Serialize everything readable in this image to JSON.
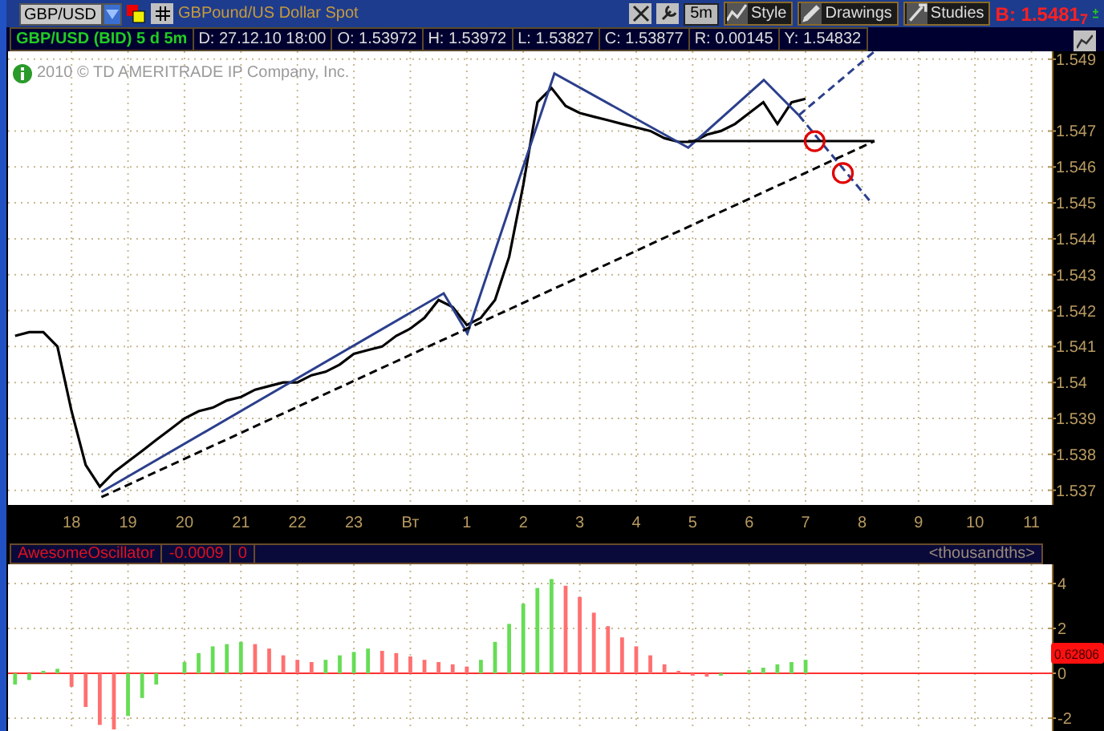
{
  "toolbar": {
    "symbol": "GBP/USD",
    "description": "GBPound/US Dollar Spot",
    "interval": "5m",
    "buttons": [
      {
        "label": "Style"
      },
      {
        "label": "Drawings"
      },
      {
        "label": "Studies"
      }
    ],
    "bid": "B: 1.5481$_{7}$"
  },
  "info_bar": {
    "title": "GBP/USD (BID) 5 d 5m",
    "fields": [
      "D: 27.12.10 18:00",
      "O: 1.53972",
      "H: 1.53972",
      "L: 1.53827",
      "C: 1.53877",
      "R: 0.00145",
      "Y: 1.54832"
    ]
  },
  "copyright": "2010 © TD AMERITRADE IP Company, Inc.",
  "price_chart": {
    "chart_data": {
      "type": "line",
      "grid": true,
      "ylim": [
        1.53659,
        1.54922
      ],
      "categories": [
        null,
        null,
        null,
        null,
        "18",
        null,
        null,
        null,
        "19",
        null,
        null,
        null,
        "20",
        null,
        null,
        null,
        "21",
        null,
        null,
        null,
        "22",
        null,
        null,
        null,
        "23",
        null,
        null,
        null,
        "Вт",
        null,
        null,
        null,
        "1",
        null,
        null,
        null,
        "2",
        null,
        null,
        null,
        "3",
        null,
        null,
        null,
        "4",
        null,
        null,
        null,
        "5",
        null,
        null,
        null,
        "6",
        null,
        null,
        null,
        "7",
        null,
        null,
        null,
        "8",
        null,
        null,
        null,
        "9",
        null,
        null,
        null,
        "10",
        null,
        null,
        null,
        "11",
        null
      ],
      "yticks": [
        1.537,
        1.538,
        1.539,
        1.54,
        1.541,
        1.542,
        1.543,
        1.544,
        1.545,
        1.546,
        1.547,
        1.549
      ],
      "series": [
        {
          "color": "#000000",
          "values": [
            1.5413,
            1.5414,
            1.5414,
            1.541,
            1.5392,
            1.5377,
            1.5371,
            1.5375,
            1.5378,
            1.5381,
            1.5384,
            1.5387,
            1.539,
            1.5392,
            1.5393,
            1.5395,
            1.5396,
            1.5398,
            1.5399,
            1.54,
            1.54,
            1.5402,
            1.5403,
            1.5405,
            1.5408,
            1.5409,
            1.541,
            1.5413,
            1.5415,
            1.5418,
            1.5423,
            1.5421,
            1.5416,
            1.5418,
            1.5423,
            1.5435,
            1.5455,
            1.5478,
            1.5482,
            1.5477,
            1.5475,
            1.5474,
            1.5473,
            1.5472,
            1.5471,
            1.547,
            1.5468,
            1.5467,
            1.5467,
            1.5469,
            1.547,
            1.5472,
            1.5475,
            1.5478,
            1.5472,
            1.5478,
            1.5479,
            null,
            null,
            null,
            null,
            null,
            null,
            null,
            null,
            null,
            null,
            null,
            null,
            null,
            null,
            null,
            null,
            null
          ]
        }
      ]
    }
  },
  "oscillator": {
    "name": "AwesomeOscillator",
    "value": "-0.0009",
    "field_2": "0",
    "units": "<thousandths>",
    "current_value": "0.62806",
    "chart_data": {
      "type": "bar",
      "grid": true,
      "ylim": [
        -2.571,
        4.857
      ],
      "yticks": [
        -2,
        0,
        2,
        4
      ],
      "ref_lines": [
        {
          "axis": "y",
          "value": 0,
          "color": "#ff3030"
        }
      ],
      "categories": [
        null,
        null,
        null,
        null,
        null,
        null,
        null,
        null,
        null,
        null,
        null,
        null,
        null,
        null,
        null,
        null,
        null,
        null,
        null,
        null,
        null,
        null,
        null,
        null,
        null,
        null,
        null,
        null,
        null,
        null,
        null,
        null,
        null,
        null,
        null,
        null,
        null,
        null,
        null,
        null,
        null,
        null,
        null,
        null,
        null,
        null,
        null,
        null,
        null,
        null,
        null,
        null,
        null,
        null,
        null,
        null,
        null,
        null,
        null,
        null,
        null,
        null,
        null,
        null,
        null,
        null,
        null,
        null,
        null,
        null,
        null,
        null,
        null,
        null
      ],
      "series": [
        {
          "values": [
            -0.5,
            -0.3,
            0.1,
            0.2,
            -0.6,
            -1.5,
            -2.3,
            -2.5,
            -1.9,
            -1.1,
            -0.5,
            0.0,
            0.5,
            0.9,
            1.2,
            1.3,
            1.4,
            1.3,
            1.1,
            0.8,
            0.6,
            0.5,
            0.6,
            0.8,
            0.95,
            1.1,
            1.0,
            0.9,
            0.75,
            0.6,
            0.5,
            0.4,
            0.3,
            0.6,
            1.4,
            2.2,
            3.1,
            3.8,
            4.2,
            3.9,
            3.4,
            2.7,
            2.1,
            1.6,
            1.2,
            0.8,
            0.4,
            0.1,
            -0.05,
            -0.15,
            -0.1,
            0.0,
            0.15,
            0.25,
            0.4,
            0.5,
            0.6,
            null,
            null,
            null,
            null,
            null,
            null,
            null,
            null,
            null,
            null,
            null,
            null,
            null,
            null,
            null,
            null,
            null
          ]
        }
      ]
    }
  }
}
